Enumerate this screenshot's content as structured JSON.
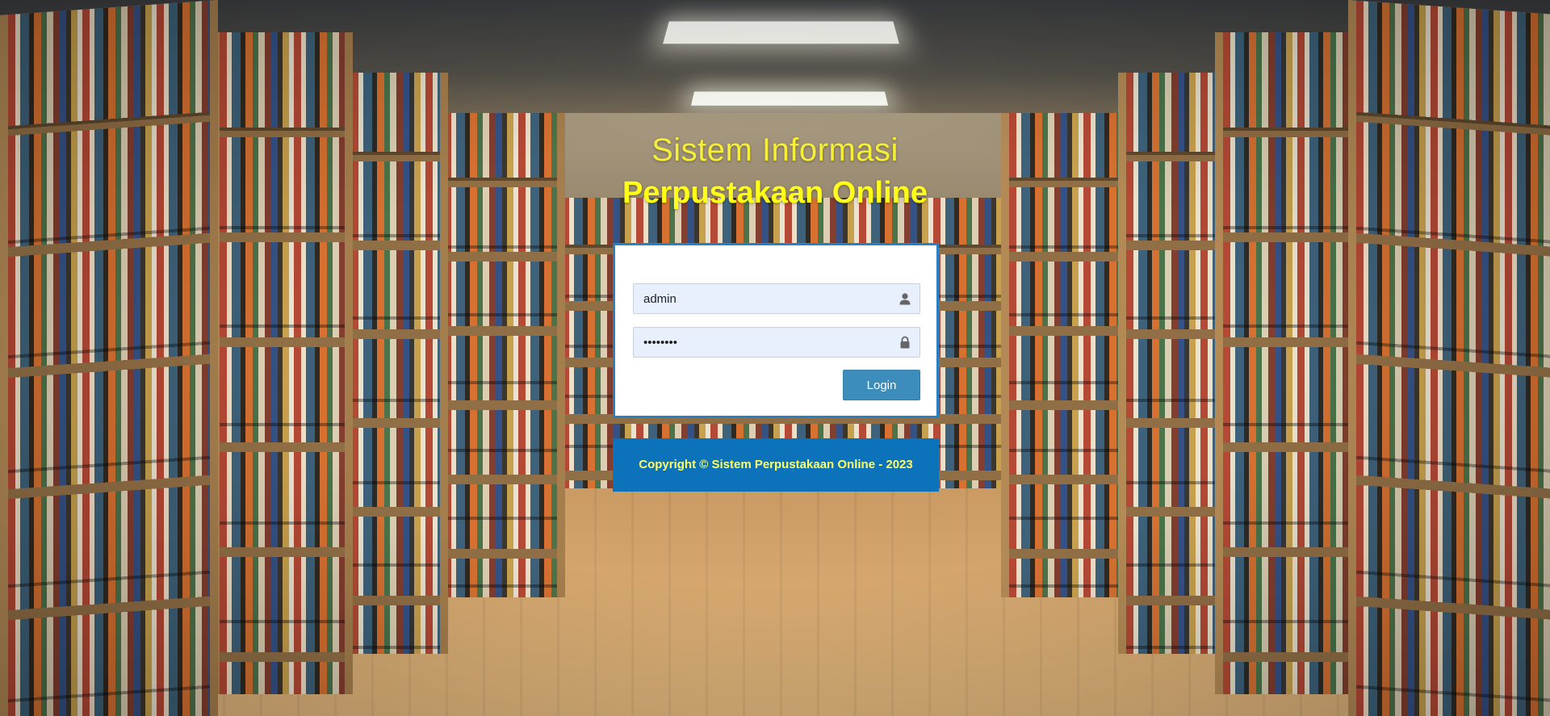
{
  "header": {
    "line1": "Sistem Informasi",
    "line2": "Perpustakaan Online"
  },
  "login": {
    "username": {
      "value": "admin",
      "icon": "user-icon"
    },
    "password": {
      "value": "••••••••",
      "icon": "lock-icon"
    },
    "submit_label": "Login"
  },
  "footer": {
    "text": "Copyright © Sistem Perpustakaan Online - 2023"
  },
  "colors": {
    "title": "#ffff1a",
    "box_border": "#2a7fc2",
    "button": "#3c8dbc",
    "footer_bg": "#0c72b9",
    "footer_text": "#ffff66"
  }
}
